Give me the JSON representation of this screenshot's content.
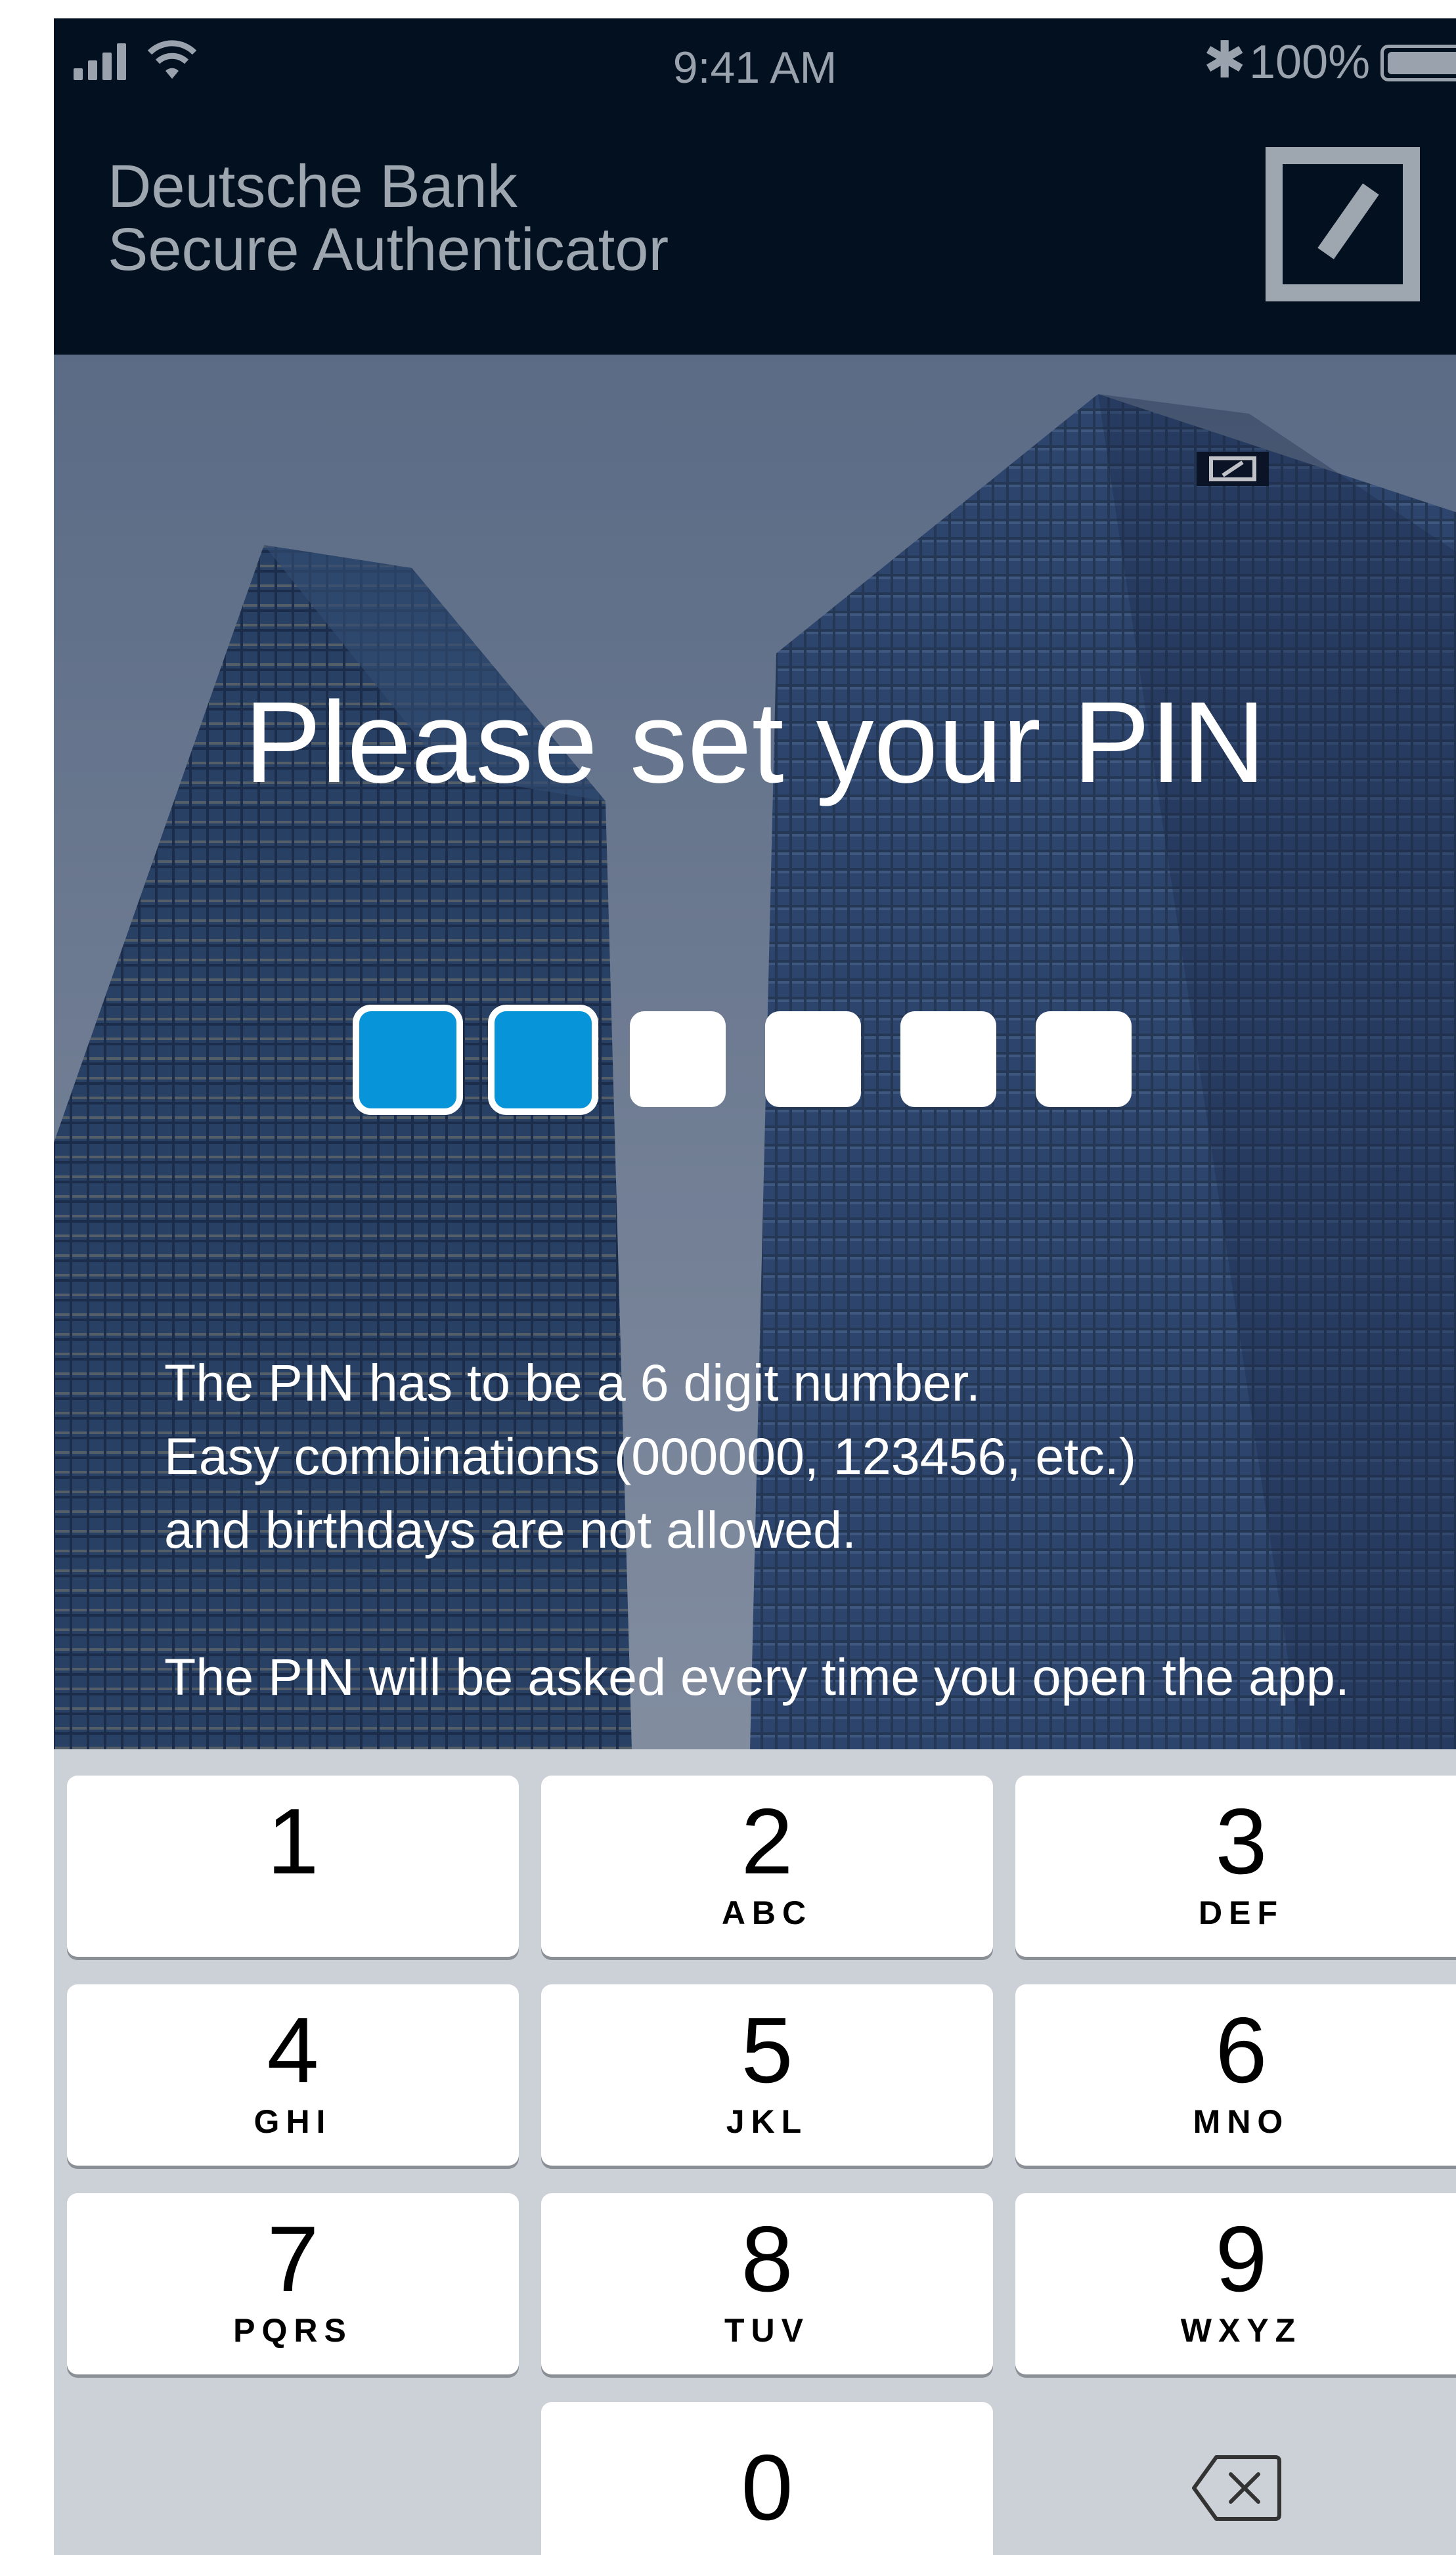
{
  "status_bar": {
    "time": "9:41 AM",
    "battery": "100%",
    "icons": [
      "signal-icon",
      "wifi-icon",
      "bluetooth-icon",
      "battery-icon"
    ]
  },
  "header": {
    "title_line1": "Deutsche Bank",
    "title_line2": "Secure Authenticator",
    "logo": "deutsche-bank-logo"
  },
  "pin": {
    "title": "Please set your PIN",
    "length": 6,
    "entered": 2,
    "filled_color": "#0894d8"
  },
  "info": {
    "line1": "The PIN has to be a 6 digit number.",
    "line2": "Easy combinations (000000, 123456, etc.)",
    "line3": "and birthdays are not allowed.",
    "line4": "The PIN will be asked every time you open the app."
  },
  "keypad": {
    "keys": [
      {
        "digit": "1",
        "letters": ""
      },
      {
        "digit": "2",
        "letters": "ABC"
      },
      {
        "digit": "3",
        "letters": "DEF"
      },
      {
        "digit": "4",
        "letters": "GHI"
      },
      {
        "digit": "5",
        "letters": "JKL"
      },
      {
        "digit": "6",
        "letters": "MNO"
      },
      {
        "digit": "7",
        "letters": "PQRS"
      },
      {
        "digit": "8",
        "letters": "TUV"
      },
      {
        "digit": "9",
        "letters": "WXYZ"
      },
      {
        "digit": "0",
        "letters": ""
      }
    ],
    "backspace_icon": "backspace-icon"
  }
}
